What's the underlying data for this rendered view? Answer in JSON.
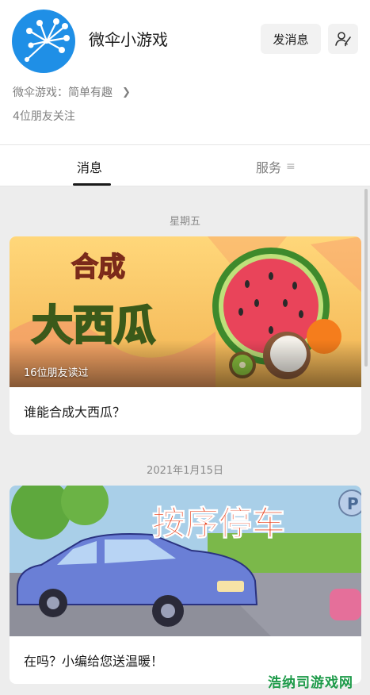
{
  "header": {
    "account_name": "微伞小游戏",
    "send_message_label": "发消息",
    "profile_icon": "person-settings-icon",
    "description": "微伞游戏：简单有趣",
    "friends_follow": "4位朋友关注"
  },
  "tabs": {
    "messages": "消息",
    "services": "服务"
  },
  "feed": [
    {
      "date": "星期五",
      "cover_title_lines": [
        "合成",
        "大西瓜"
      ],
      "readers": "16位朋友读过",
      "title": "谁能合成大西瓜？"
    },
    {
      "date": "2021年1月15日",
      "cover_title": "按序停车",
      "title": "在吗？小编给您送温暖！"
    }
  ],
  "watermark": "浩纳司游戏网",
  "colors": {
    "avatar_bg": "#1f8fe6",
    "page_bg": "#ededed",
    "watermark": "#1e9b4a"
  }
}
